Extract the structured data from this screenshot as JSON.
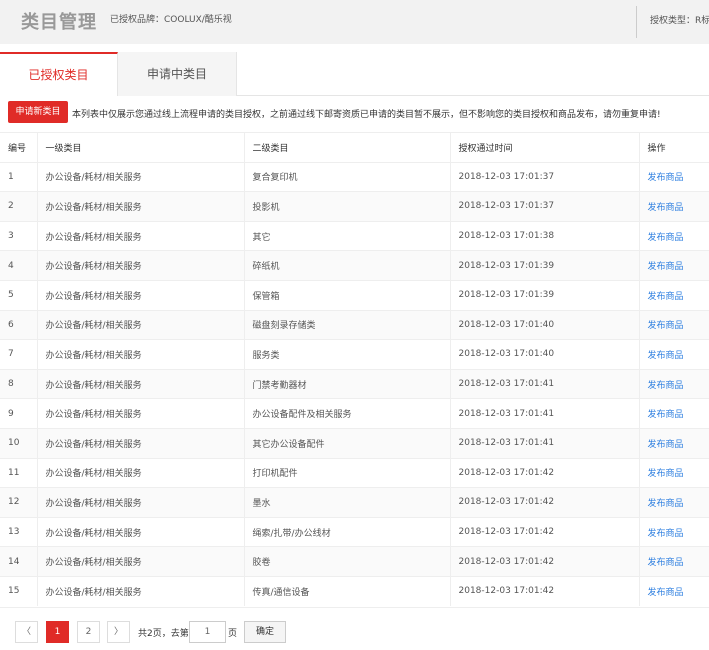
{
  "header": {
    "title": "类目管理",
    "brand": "已授权品牌：COOLUX/酷乐视",
    "auth_type": "授权类型：R标"
  },
  "tabs": [
    {
      "label": "已授权类目",
      "active": true
    },
    {
      "label": "申请中类目",
      "active": false
    }
  ],
  "apply_button": "申请新类目",
  "notice": "本列表中仅展示您通过线上流程申请的类目授权，之前通过线下邮寄资质已申请的类目暂不展示，但不影响您的类目授权和商品发布，请勿重复申请!",
  "table": {
    "columns": [
      "编号",
      "一级类目",
      "二级类目",
      "授权通过时间",
      "操作"
    ],
    "rows": [
      {
        "no": "1",
        "l1": "办公设备/耗材/相关服务",
        "l2": "复合复印机",
        "time": "2018-12-03 17:01:37",
        "op": "发布商品"
      },
      {
        "no": "2",
        "l1": "办公设备/耗材/相关服务",
        "l2": "投影机",
        "time": "2018-12-03 17:01:37",
        "op": "发布商品"
      },
      {
        "no": "3",
        "l1": "办公设备/耗材/相关服务",
        "l2": "其它",
        "time": "2018-12-03 17:01:38",
        "op": "发布商品"
      },
      {
        "no": "4",
        "l1": "办公设备/耗材/相关服务",
        "l2": "碎纸机",
        "time": "2018-12-03 17:01:39",
        "op": "发布商品"
      },
      {
        "no": "5",
        "l1": "办公设备/耗材/相关服务",
        "l2": "保管箱",
        "time": "2018-12-03 17:01:39",
        "op": "发布商品"
      },
      {
        "no": "6",
        "l1": "办公设备/耗材/相关服务",
        "l2": "磁盘刻录存储类",
        "time": "2018-12-03 17:01:40",
        "op": "发布商品"
      },
      {
        "no": "7",
        "l1": "办公设备/耗材/相关服务",
        "l2": "服务类",
        "time": "2018-12-03 17:01:40",
        "op": "发布商品"
      },
      {
        "no": "8",
        "l1": "办公设备/耗材/相关服务",
        "l2": "门禁考勤器材",
        "time": "2018-12-03 17:01:41",
        "op": "发布商品"
      },
      {
        "no": "9",
        "l1": "办公设备/耗材/相关服务",
        "l2": "办公设备配件及相关服务",
        "time": "2018-12-03 17:01:41",
        "op": "发布商品"
      },
      {
        "no": "10",
        "l1": "办公设备/耗材/相关服务",
        "l2": "其它办公设备配件",
        "time": "2018-12-03 17:01:41",
        "op": "发布商品"
      },
      {
        "no": "11",
        "l1": "办公设备/耗材/相关服务",
        "l2": "打印机配件",
        "time": "2018-12-03 17:01:42",
        "op": "发布商品"
      },
      {
        "no": "12",
        "l1": "办公设备/耗材/相关服务",
        "l2": "墨水",
        "time": "2018-12-03 17:01:42",
        "op": "发布商品"
      },
      {
        "no": "13",
        "l1": "办公设备/耗材/相关服务",
        "l2": "绳索/扎带/办公线材",
        "time": "2018-12-03 17:01:42",
        "op": "发布商品"
      },
      {
        "no": "14",
        "l1": "办公设备/耗材/相关服务",
        "l2": "胶卷",
        "time": "2018-12-03 17:01:42",
        "op": "发布商品"
      },
      {
        "no": "15",
        "l1": "办公设备/耗材/相关服务",
        "l2": "传真/通信设备",
        "time": "2018-12-03 17:01:42",
        "op": "发布商品"
      }
    ]
  },
  "pagination": {
    "prev": "〈",
    "pages": [
      "1",
      "2"
    ],
    "current": "1",
    "next": "〉",
    "total_text": "共2页，去第",
    "input_value": "1",
    "unit": "页",
    "confirm": "确定"
  },
  "colors": {
    "accent": "#e02b27",
    "link": "#2e7fe0"
  }
}
